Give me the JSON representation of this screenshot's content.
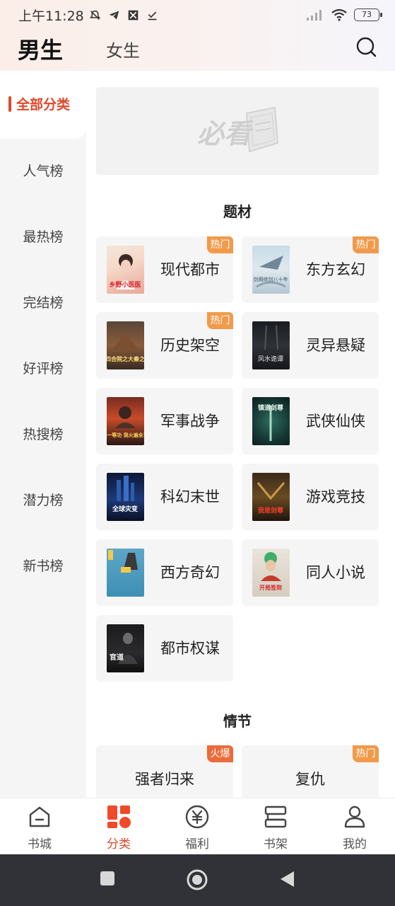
{
  "status_bar": {
    "time": "上午11:28",
    "battery": "73",
    "icons": [
      "mute-bell-icon",
      "telegram-icon",
      "app-notification-icon",
      "download-done-icon",
      "signal-icon",
      "wifi-icon",
      "battery-icon"
    ]
  },
  "header": {
    "tab_male": "男生",
    "tab_female": "女生",
    "search_icon": "search-icon"
  },
  "sidebar": {
    "items": [
      {
        "label": "全部分类",
        "active": true
      },
      {
        "label": "人气榜"
      },
      {
        "label": "最热榜"
      },
      {
        "label": "完结榜"
      },
      {
        "label": "好评榜"
      },
      {
        "label": "热搜榜"
      },
      {
        "label": "潜力榜"
      },
      {
        "label": "新书榜"
      }
    ]
  },
  "banner": {
    "logo_text": "必看"
  },
  "section_subjects": {
    "title": "题材",
    "items": [
      {
        "label": "现代都市",
        "badge": "热门",
        "cover_title": "乡野小医医"
      },
      {
        "label": "东方玄幻",
        "badge": "热门",
        "cover_title": "剑阁修剑八十年"
      },
      {
        "label": "历史架空",
        "badge": "热门",
        "cover_title": "四合院之大秦之"
      },
      {
        "label": "灵异悬疑",
        "badge": "",
        "cover_title": "风水诡谭"
      },
      {
        "label": "军事战争",
        "badge": "",
        "cover_title": "立一等功 我火遍全军"
      },
      {
        "label": "武侠仙侠",
        "badge": "",
        "cover_title": "镇道剑尊"
      },
      {
        "label": "科幻末世",
        "badge": "",
        "cover_title": "全球灾变"
      },
      {
        "label": "游戏竞技",
        "badge": "",
        "cover_title": "我是剑尊"
      },
      {
        "label": "西方奇幻",
        "badge": "",
        "cover_title": ""
      },
      {
        "label": "同人小说",
        "badge": "",
        "cover_title": "开局签到"
      },
      {
        "label": "都市权谋",
        "badge": "",
        "cover_title": "官道"
      }
    ]
  },
  "section_plots": {
    "title": "情节",
    "items": [
      {
        "label": "强者归来",
        "badge": "火爆"
      },
      {
        "label": "复仇",
        "badge": "热门"
      }
    ]
  },
  "bottom_nav": {
    "items": [
      {
        "label": "书城",
        "icon": "home-icon"
      },
      {
        "label": "分类",
        "icon": "category-icon",
        "active": true
      },
      {
        "label": "福利",
        "icon": "yuan-coin-icon"
      },
      {
        "label": "书架",
        "icon": "bookshelf-icon"
      },
      {
        "label": "我的",
        "icon": "profile-icon"
      }
    ]
  },
  "system_nav": {
    "buttons": [
      "recents-square-icon",
      "home-circle-icon",
      "back-triangle-icon"
    ]
  },
  "colors": {
    "accent": "#e0482a",
    "badge_hot": "#f09a4a",
    "badge_fire": "#ec6b3a",
    "sidebar_bg": "#f5f5f5",
    "card_bg": "#f5f5f5",
    "system_bar": "#303237"
  }
}
